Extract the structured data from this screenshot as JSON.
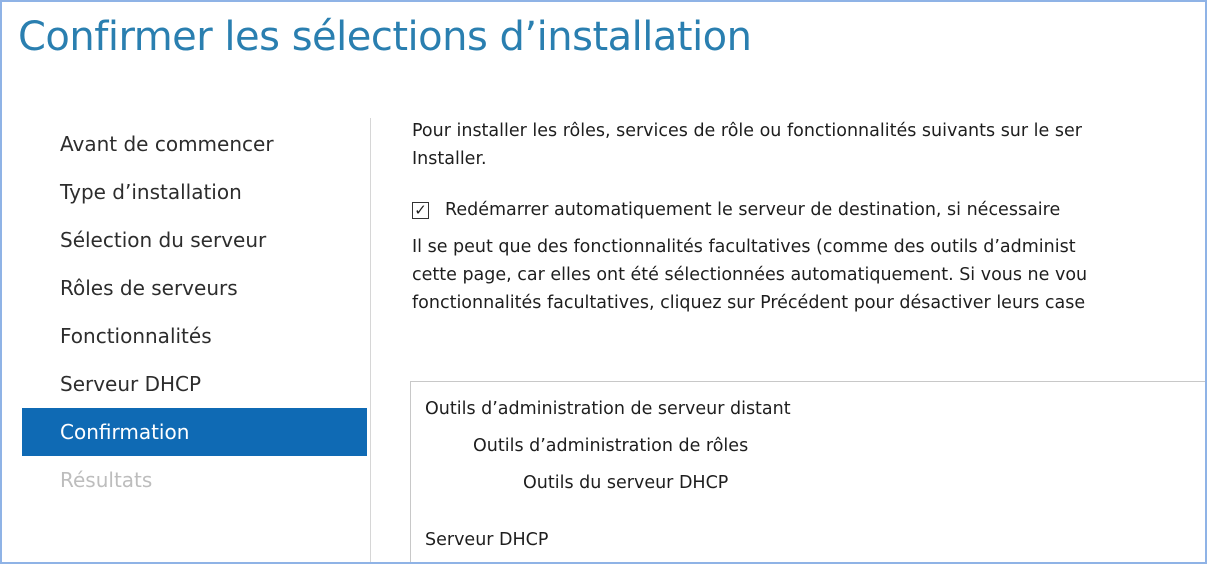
{
  "title": "Confirmer les sélections d’installation",
  "sidebar": {
    "items": [
      {
        "label": "Avant de commencer",
        "state": "normal"
      },
      {
        "label": "Type d’installation",
        "state": "normal"
      },
      {
        "label": "Sélection du serveur",
        "state": "normal"
      },
      {
        "label": "Rôles de serveurs",
        "state": "normal"
      },
      {
        "label": "Fonctionnalités",
        "state": "normal"
      },
      {
        "label": "Serveur DHCP",
        "state": "normal"
      },
      {
        "label": "Confirmation",
        "state": "active"
      },
      {
        "label": "Résultats",
        "state": "disabled"
      }
    ]
  },
  "main": {
    "intro_line1": "Pour installer les rôles, services de rôle ou fonctionnalités suivants sur le ser",
    "intro_line2": "Installer.",
    "restart_checkbox": {
      "checked": true,
      "label": "Redémarrer automatiquement le serveur de destination, si nécessaire"
    },
    "note_lines": [
      "Il se peut que des fonctionnalités facultatives (comme des outils d’administ",
      "cette page, car elles ont été sélectionnées automatiquement. Si vous ne vou",
      "fonctionnalités facultatives, cliquez sur Précédent pour désactiver leurs case"
    ],
    "selections": [
      {
        "label": "Outils d’administration de serveur distant",
        "level": 0
      },
      {
        "label": "Outils d’administration de rôles",
        "level": 1
      },
      {
        "label": "Outils du serveur DHCP",
        "level": 2
      },
      {
        "label": "Serveur DHCP",
        "level": 0
      }
    ]
  },
  "colors": {
    "title": "#2a7fb0",
    "active_nav_bg": "#0f6ab4",
    "disabled_text": "#bdbdbd",
    "frame_border": "#8fb3e6"
  }
}
